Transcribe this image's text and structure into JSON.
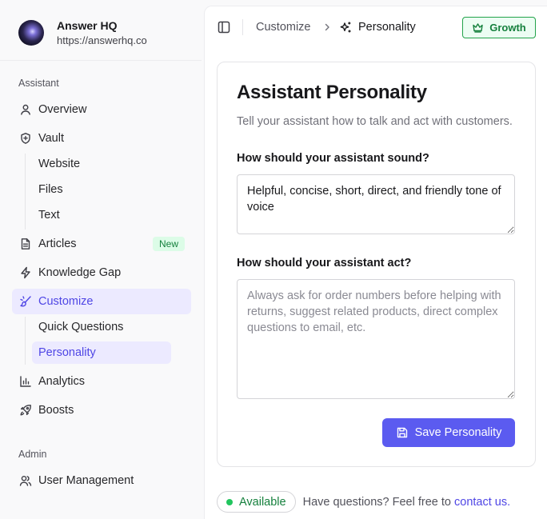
{
  "brand": {
    "name": "Answer HQ",
    "url": "https://answerhq.co"
  },
  "sidebar": {
    "sections": {
      "assistant": "Assistant",
      "admin": "Admin"
    },
    "items": {
      "overview": "Overview",
      "vault": "Vault",
      "website": "Website",
      "files": "Files",
      "text": "Text",
      "articles": "Articles",
      "articles_badge": "New",
      "knowledge_gap": "Knowledge Gap",
      "customize": "Customize",
      "quick_questions": "Quick Questions",
      "personality": "Personality",
      "analytics": "Analytics",
      "boosts": "Boosts",
      "user_management": "User Management"
    }
  },
  "header": {
    "breadcrumb_parent": "Customize",
    "breadcrumb_current": "Personality",
    "plan_badge": "Growth"
  },
  "card": {
    "title": "Assistant Personality",
    "subtitle": "Tell your assistant how to talk and act with customers.",
    "sound_label": "How should your assistant sound?",
    "sound_value": "Helpful, concise, short, direct, and friendly tone of voice",
    "act_label": "How should your assistant act?",
    "act_placeholder": "Always ask for order numbers before helping with returns, suggest related products, direct complex questions to email, etc.",
    "save_label": "Save Personality"
  },
  "footer": {
    "status": "Available",
    "help_text": "Have questions? Feel free to",
    "help_link": "contact us."
  },
  "colors": {
    "accent": "#5b5bf0",
    "accent_text": "#4f46e5",
    "active_bg": "#eceaff",
    "success": "#15803d"
  }
}
